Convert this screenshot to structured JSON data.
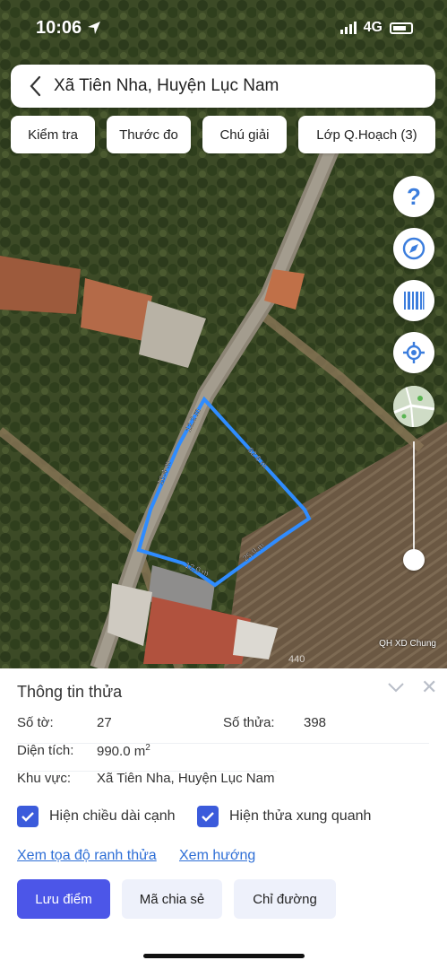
{
  "status_bar": {
    "time": "10:06",
    "network": "4G"
  },
  "header": {
    "back_icon": "chevron-left",
    "title": "Xã Tiên Nha, Huyện Lục Nam"
  },
  "toolbar": {
    "chips": [
      "Kiểm tra",
      "Thước đo",
      "Chú giải",
      "Lớp Q.Hoạch (3)"
    ]
  },
  "map": {
    "controls": [
      "help-icon",
      "compass-icon",
      "barcode-icon",
      "locate-icon",
      "map-layer-thumbnail"
    ],
    "help_glyph": "?",
    "zoom_level": 0.15,
    "edge_labels": [
      "12.2 m",
      "16.4 m",
      "62.6 m",
      "25.9 m",
      "12.0 m"
    ],
    "credit": "QH XD Chung",
    "parcel_label": "440"
  },
  "info": {
    "title": "Thông tin thửa",
    "so_to_label": "Số tờ:",
    "so_to_value": "27",
    "so_thua_label": "Số thửa:",
    "so_thua_value": "398",
    "dien_tich_label": "Diện tích:",
    "dien_tich_value": "990.0 m",
    "dien_tich_unit_sup": "2",
    "khu_vuc_label": "Khu vực:",
    "khu_vuc_value": "Xã Tiên Nha, Huyện Lục Nam",
    "checkbox_1": "Hiện chiều dài cạnh",
    "checkbox_2": "Hiện thửa xung quanh",
    "link_1": "Xem tọa độ ranh thửa",
    "link_2": "Xem hướng",
    "btn_save": "Lưu điểm",
    "btn_share": "Mã chia sẻ",
    "btn_route": "Chỉ đường",
    "close_glyph": "✕"
  },
  "colors": {
    "parcel_outline": "#2f8cff",
    "primary": "#4c56e8",
    "link": "#2f6fd6",
    "checkbox": "#3b5bdb"
  }
}
